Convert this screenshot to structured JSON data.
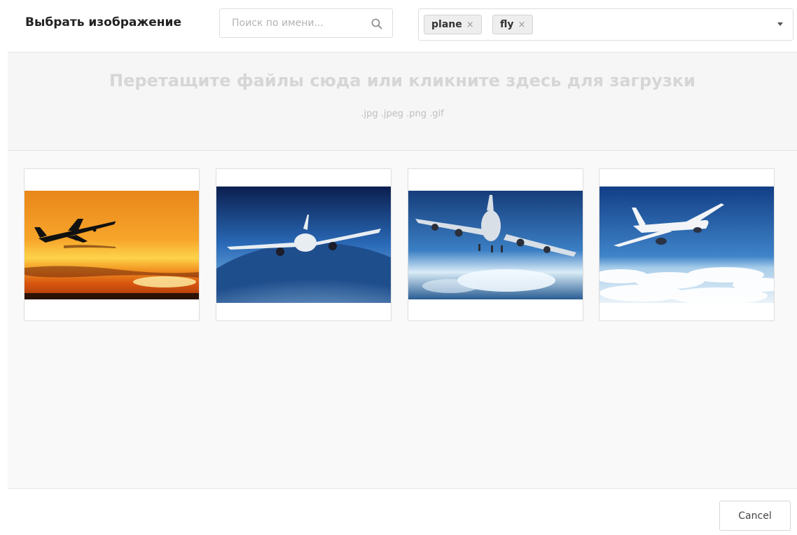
{
  "header": {
    "title": "Выбрать изображение",
    "search": {
      "placeholder": "Поиск по имени...",
      "value": ""
    },
    "tags": [
      "plane",
      "fly"
    ],
    "tag_remove_glyph": "×"
  },
  "dropzone": {
    "title": "Перетащите файлы сюда или кликните здесь для загрузки",
    "formats": ".jpg .jpeg .png .gif"
  },
  "gallery": {
    "images": [
      {
        "subject": "airplane-silhouette-sunset"
      },
      {
        "subject": "airliner-over-earth"
      },
      {
        "subject": "jumbo-jet-landing"
      },
      {
        "subject": "airliner-above-clouds"
      }
    ]
  },
  "footer": {
    "cancel_label": "Cancel"
  },
  "colors": {
    "border": "#dddddd",
    "dropzone_bg": "#f6f6f6",
    "gallery_bg": "#f9f9f9",
    "tag_bg": "#eeeeee"
  }
}
